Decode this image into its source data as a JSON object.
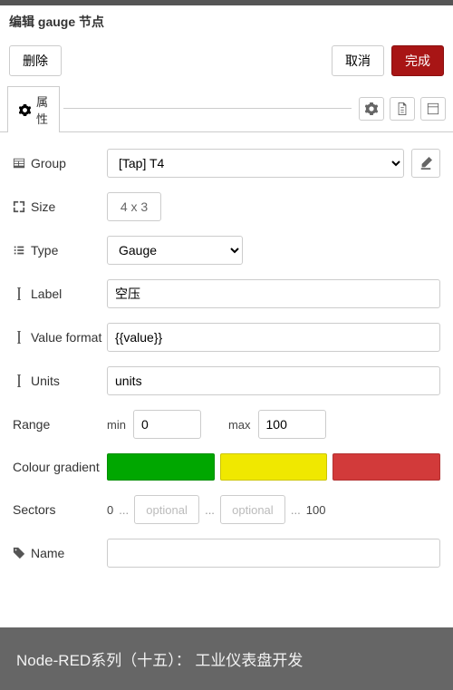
{
  "dialog": {
    "title": "编辑 gauge 节点"
  },
  "buttons": {
    "delete": "删除",
    "cancel": "取消",
    "done": "完成"
  },
  "tabs": {
    "properties": "属性"
  },
  "form": {
    "group": {
      "label": "Group",
      "value": "[Tap] T4"
    },
    "size": {
      "label": "Size",
      "value": "4 x 3"
    },
    "type": {
      "label": "Type",
      "value": "Gauge"
    },
    "labelField": {
      "label": "Label",
      "value": "空压"
    },
    "valueFormat": {
      "label": "Value format",
      "value": "{{value}}"
    },
    "units": {
      "label": "Units",
      "value": "units"
    },
    "range": {
      "label": "Range",
      "minLabel": "min",
      "min": "0",
      "maxLabel": "max",
      "max": "100"
    },
    "colours": {
      "label": "Colour gradient",
      "c1": "#00a700",
      "c2": "#f0e800",
      "c3": "#d23a3a"
    },
    "sectors": {
      "label": "Sectors",
      "start": "0",
      "end": "100",
      "placeholder": "optional",
      "dots": "..."
    },
    "name": {
      "label": "Name",
      "value": ""
    }
  },
  "footer": {
    "text": "Node-RED系列（十五）： 工业仪表盘开发"
  }
}
